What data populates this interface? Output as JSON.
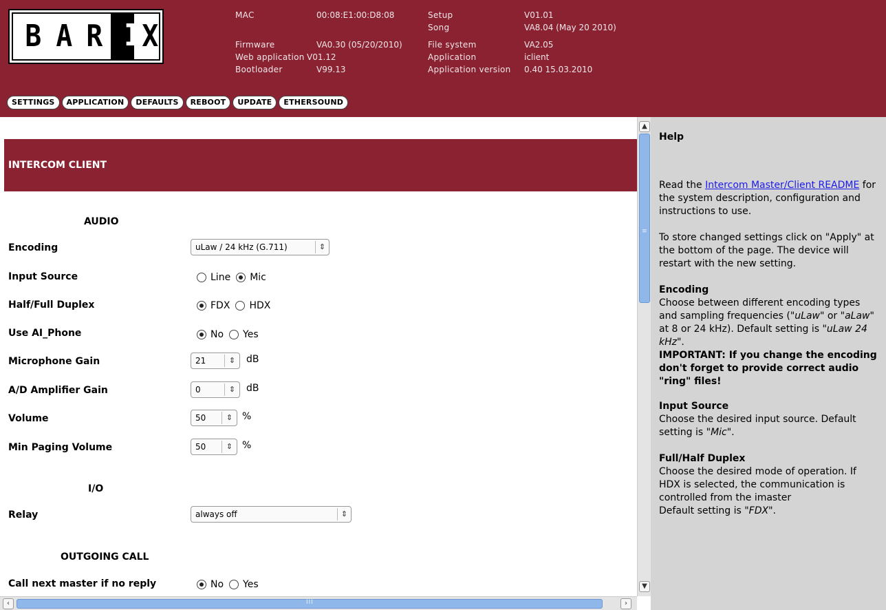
{
  "header": {
    "logo": {
      "letters": [
        "B",
        "A",
        "R",
        "I",
        "X"
      ]
    },
    "info": {
      "mac_label": "MAC",
      "mac_value": "00:08:E1:00:D8:08",
      "firmware_label": "Firmware",
      "firmware_value": "VA0.30 (05/20/2010)",
      "webapp_label": "Web application",
      "webapp_value": "V01.12",
      "bootloader_label": "Bootloader",
      "bootloader_value": "V99.13",
      "setup_label": "Setup",
      "setup_value": "V01.01",
      "song_label": "Song",
      "song_value": "VA8.04 (May 20 2010)",
      "filesystem_label": "File system",
      "filesystem_value": "VA2.05",
      "application_label": "Application",
      "application_value": "iclient",
      "appversion_label": "Application version",
      "appversion_value": "0.40 15.03.2010"
    },
    "nav": [
      "SETTINGS",
      "APPLICATION",
      "DEFAULTS",
      "REBOOT",
      "UPDATE",
      "ETHERSOUND"
    ]
  },
  "main": {
    "section_title": "INTERCOM CLIENT",
    "audio": {
      "title": "AUDIO",
      "encoding_label": "Encoding",
      "encoding_value": "uLaw / 24 kHz (G.711)",
      "input_source_label": "Input Source",
      "input_line": "Line",
      "input_mic": "Mic",
      "duplex_label": "Half/Full Duplex",
      "duplex_fdx": "FDX",
      "duplex_hdx": "HDX",
      "aiphone_label": "Use AI_Phone",
      "aiphone_no": "No",
      "aiphone_yes": "Yes",
      "mic_gain_label": "Microphone Gain",
      "mic_gain_value": "21",
      "mic_gain_unit": "dB",
      "ad_gain_label": "A/D Amplifier Gain",
      "ad_gain_value": "0",
      "ad_gain_unit": "dB",
      "volume_label": "Volume",
      "volume_value": "50",
      "volume_unit": "%",
      "min_paging_label": "Min Paging Volume",
      "min_paging_value": "50",
      "min_paging_unit": "%"
    },
    "io": {
      "title": "I/O",
      "relay_label": "Relay",
      "relay_value": "always off"
    },
    "outgoing": {
      "title": "OUTGOING CALL",
      "call_next_label": "Call next master if no reply",
      "call_next_no": "No",
      "call_next_yes": "Yes"
    }
  },
  "help": {
    "title": "Help",
    "intro_pre": "Read the ",
    "intro_link": "Intercom Master/Client README",
    "intro_post": " for the system description, configuration and instructions to use.",
    "store": "To store changed settings click on \"Apply\" at the bottom of the page. The device will restart with the new setting.",
    "encoding_title": "Encoding",
    "encoding_text_1": "Choose between different encoding types and sampling frequencies (\"",
    "encoding_ulaw": "uLaw",
    "encoding_text_2": "\" or \"",
    "encoding_alaw": "aLaw",
    "encoding_text_3": "\" at 8 or 24 kHz). Default setting is \"",
    "encoding_default": "uLaw 24 kHz",
    "encoding_text_4": "\".",
    "encoding_important": "IMPORTANT: If you change the encoding don't forget to provide correct audio \"ring\" files!",
    "input_title": "Input Source",
    "input_text_1": "Choose the desired input source. Default setting is \"",
    "input_default": "Mic",
    "input_text_2": "\".",
    "duplex_title": "Full/Half Duplex",
    "duplex_text": "Choose the desired mode of operation. If HDX is selected, the communication is controlled from the imaster",
    "duplex_default_pre": "Default setting is \"",
    "duplex_default": "FDX",
    "duplex_default_post": "\"."
  }
}
